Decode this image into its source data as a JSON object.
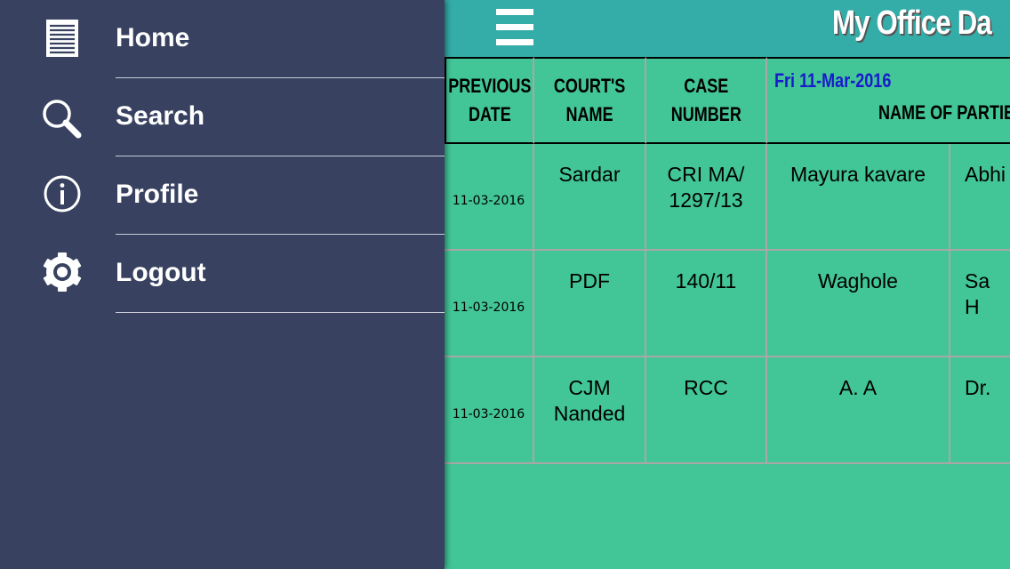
{
  "app": {
    "title": "My Office Da"
  },
  "topbar": {
    "menu_icon": "hamburger-icon"
  },
  "sidebar": {
    "items": [
      {
        "label": "Home",
        "icon": "document-lines-icon"
      },
      {
        "label": "Search",
        "icon": "magnifier-icon"
      },
      {
        "label": "Profile",
        "icon": "info-icon"
      },
      {
        "label": "Logout",
        "icon": "gear-icon"
      }
    ]
  },
  "table": {
    "headers": {
      "previous_date": "PREVIOUS\nDATE",
      "court_name": "COURT'S\nNAME",
      "case_number": "CASE\nNUMBER",
      "current_date": "Fri 11-Mar-2016",
      "parties": "NAME OF PARTIE"
    },
    "rows": [
      {
        "date": "11-03-2016",
        "court": "Sardar",
        "case": "CRI MA/\n1297/13",
        "party1": "Mayura kavare",
        "party2": "Abhi"
      },
      {
        "date": "11-03-2016",
        "court": "PDF",
        "case": "140/11",
        "party1": "Waghole",
        "party2": "Sa\nH"
      },
      {
        "date": "11-03-2016",
        "court": "CJM\nNanded",
        "case": "RCC",
        "party1": "A. A",
        "party2": "Dr."
      }
    ]
  },
  "colors": {
    "sidebar_bg": "#384260",
    "topbar_bg": "#34aca8",
    "content_bg": "#42c597",
    "date_accent": "#1a1acc"
  }
}
